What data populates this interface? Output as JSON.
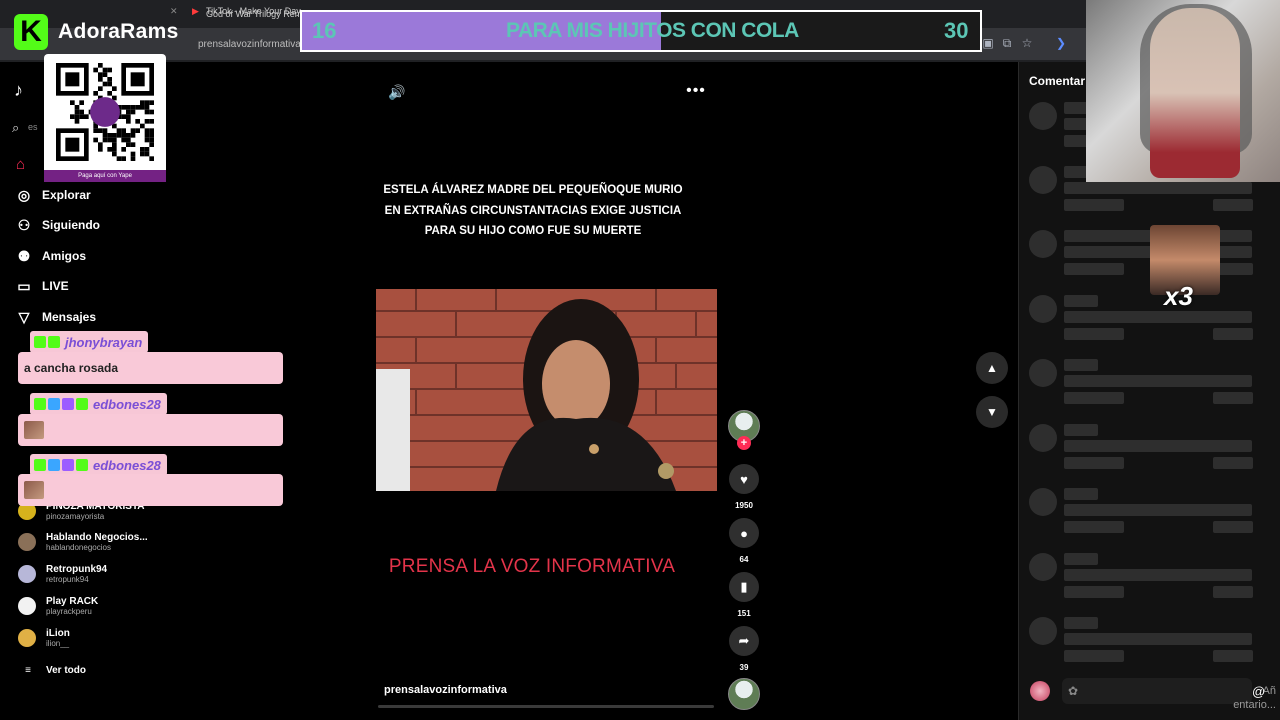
{
  "browser": {
    "tabs": [
      "TikTok - Make Your Day",
      "God of War Trilogy Remak"
    ],
    "url": "prensalavozinformativa/vide"
  },
  "overlay": {
    "streamer": "AdoraRams",
    "goal_current": "16",
    "goal_title": "PARA MIS HIJITOS CON COLA",
    "goal_target": "30",
    "goal_progress_fraction": 0.53,
    "qr_caption": "Paga aquí con Yape",
    "emote_text": "x3"
  },
  "sidebar": {
    "nav": [
      {
        "label": "Explorar",
        "icon": "compass-icon"
      },
      {
        "label": "Siguiendo",
        "icon": "following-icon"
      },
      {
        "label": "Amigos",
        "icon": "friends-icon"
      },
      {
        "label": "LIVE",
        "icon": "live-icon"
      },
      {
        "label": "Mensajes",
        "icon": "messages-icon"
      }
    ],
    "accounts": [
      {
        "name": "PINOZA MAYORISTA",
        "handle": "pinozamayorista"
      },
      {
        "name": "Hablando Negocios...",
        "handle": "hablandonegocios"
      },
      {
        "name": "Retropunk94",
        "handle": "retropunk94"
      },
      {
        "name": "Play RACK",
        "handle": "playrackperu"
      },
      {
        "name": "iLion",
        "handle": "ilion__"
      }
    ],
    "see_all": "Ver todo"
  },
  "chat": [
    {
      "user": "jhonybrayan",
      "message": "a cancha rosada"
    },
    {
      "user": "edbones28",
      "message": ""
    },
    {
      "user": "edbones28",
      "message": ""
    }
  ],
  "video": {
    "headline_lines": [
      "ESTELA ÁLVAREZ MADRE DEL PEQUEÑOQUE MURIO",
      "EN EXTRAÑAS CIRCUNSTANTACIAS EXIGE JUSTICIA",
      "PARA SU HIJO COMO FUE SU MUERTE"
    ],
    "brand_footer": "PRENSA LA VOZ INFORMATIVA",
    "author": "prensalavozinformativa"
  },
  "actions": {
    "likes": "1950",
    "comments": "64",
    "saves": "151",
    "shares": "39"
  },
  "comments_panel": {
    "title": "Comentar",
    "placeholder_line1": "Añ",
    "placeholder_line2": "entario..."
  },
  "colors": {
    "accent": "#fe2c55",
    "kick_green": "#53fc18",
    "goal_fill": "#9b79d9",
    "goal_text": "#5cc6b5",
    "chat_bg": "#f9c9d8",
    "footer_red": "#e3344a"
  }
}
